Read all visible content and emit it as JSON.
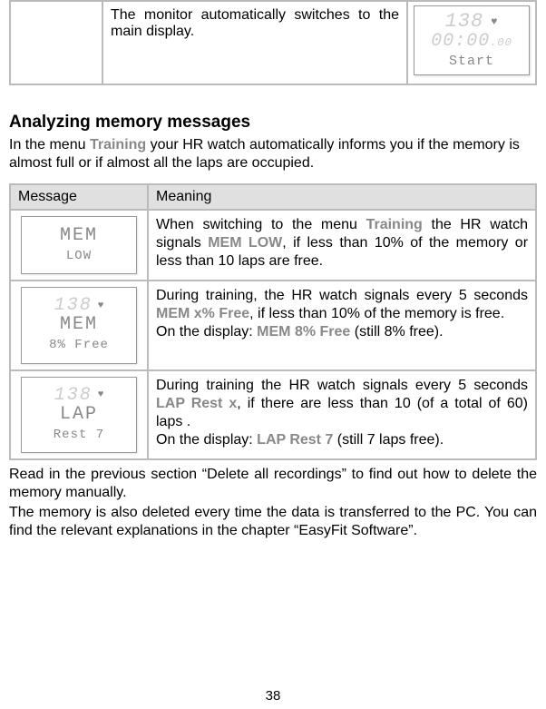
{
  "topRow": {
    "desc": "The monitor automatically switches to the main display.",
    "lcd": {
      "r1": "138",
      "r2": "00:00",
      "r2suffix": ".00",
      "r3": "Start"
    }
  },
  "section": {
    "heading": "Analyzing memory messages",
    "intro_a": "In the menu ",
    "intro_training": "Training",
    "intro_b": " your HR watch automatically informs you if the memory is almost full or if almost all the laps are occupied."
  },
  "table": {
    "h1": "Message",
    "h2": "Meaning",
    "rows": [
      {
        "lcd": {
          "r1": "",
          "r2": "MEM",
          "r3": "LOW"
        },
        "parts": [
          "When switching to the menu ",
          "Training",
          " the HR watch signals ",
          "MEM LOW",
          ", if less than 10% of the memory or less than 10 laps are free."
        ]
      },
      {
        "lcd": {
          "r1": "138",
          "r2": "MEM",
          "r3": "8% Free"
        },
        "parts": [
          "During training, the HR watch signals every 5 seconds ",
          "MEM x% Free",
          ", if less than 10% of the memory is free.",
          "On the display: ",
          "MEM 8% Free",
          " (still 8% free)."
        ]
      },
      {
        "lcd": {
          "r1": "138",
          "r2": "LAP",
          "r3": "Rest  7"
        },
        "parts": [
          "During training the HR watch signals every 5 seconds  ",
          "LAP Rest x",
          ", if there are less than 10 (of a total of 60) laps .",
          "On the display: ",
          "LAP Rest 7",
          " (still 7 laps free)."
        ]
      }
    ]
  },
  "footer": {
    "p1": "Read in the previous section “Delete all recordings” to find out how to delete the memory manually.",
    "p2": "The memory is also deleted every time the data is transferred to the PC. You can find the relevant explanations in the chapter “EasyFit Software”."
  },
  "pageNumber": "38"
}
